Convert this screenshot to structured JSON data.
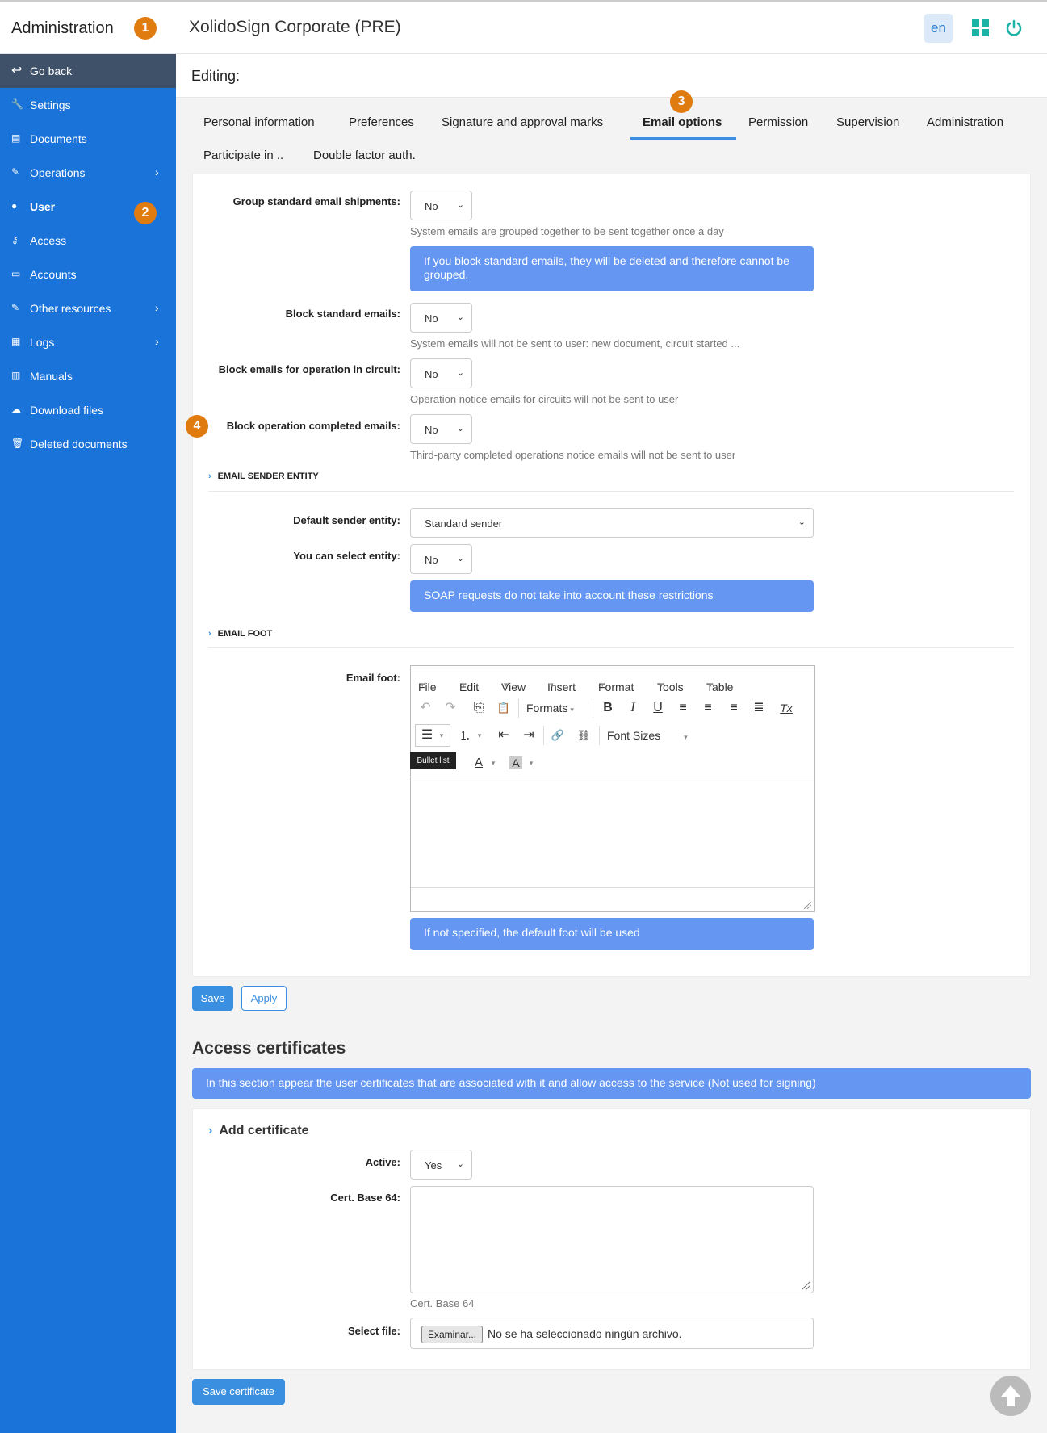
{
  "header": {
    "admin_title": "Administration",
    "app_title": "XolidoSign Corporate (PRE)",
    "lang": "en",
    "badges": [
      "1",
      "2",
      "3",
      "4"
    ]
  },
  "sidebar": {
    "back_label": "Go back",
    "items": [
      {
        "label": "Settings",
        "icon": "wrench-icon"
      },
      {
        "label": "Documents",
        "icon": "document-icon"
      },
      {
        "label": "Operations",
        "icon": "edit-icon",
        "has_children": true
      },
      {
        "label": "User",
        "icon": "user-icon",
        "active": true
      },
      {
        "label": "Access",
        "icon": "key-icon"
      },
      {
        "label": "Accounts",
        "icon": "id-card-icon"
      },
      {
        "label": "Other resources",
        "icon": "edit-icon",
        "has_children": true
      },
      {
        "label": "Logs",
        "icon": "log-icon",
        "has_children": true
      },
      {
        "label": "Manuals",
        "icon": "book-icon"
      },
      {
        "label": "Download files",
        "icon": "cloud-download-icon"
      },
      {
        "label": "Deleted documents",
        "icon": "trash-icon"
      }
    ],
    "chevron": "›"
  },
  "editing": {
    "label": "Editing:"
  },
  "tabs": [
    "Personal information",
    "Preferences",
    "Signature and approval marks",
    "Email options",
    "Permission",
    "Supervision",
    "Administration",
    "Participate in ..",
    "Double factor auth."
  ],
  "form": {
    "group_standard": {
      "label": "Group standard email shipments:",
      "value": "No",
      "help": "System emails are grouped together to be sent together once a day"
    },
    "block_info": "If you block standard emails, they will be deleted and therefore cannot be grouped.",
    "block_standard": {
      "label": "Block standard emails:",
      "value": "No",
      "help": "System emails will not be sent to user: new document, circuit started ..."
    },
    "block_circuit": {
      "label": "Block emails for operation in circuit:",
      "value": "No",
      "help": "Operation notice emails for circuits will not be sent to user"
    },
    "block_completed": {
      "label": "Block operation completed emails:",
      "value": "No",
      "help": "Third-party completed operations notice emails will not be sent to user"
    },
    "sender_section": "EMAIL SENDER ENTITY",
    "default_sender": {
      "label": "Default sender entity:",
      "value": "Standard sender"
    },
    "select_entity": {
      "label": "You can select entity:",
      "value": "No"
    },
    "soap_info": "SOAP requests do not take into account these restrictions",
    "foot_section": "EMAIL FOOT",
    "email_foot_label": "Email foot:",
    "foot_info": "If not specified, the default foot will be used",
    "save": "Save",
    "apply": "Apply"
  },
  "editor": {
    "menus": [
      "File",
      "Edit",
      "View",
      "Insert",
      "Format",
      "Tools",
      "Table"
    ],
    "formats": "Formats",
    "font_sizes": "Font Sizes",
    "tooltip": "Bullet list",
    "dropdown_arrow": "▾",
    "glyphs": {
      "undo": "↶",
      "redo": "↷",
      "copy": "⎘",
      "paste": "📋",
      "bold": "B",
      "italic": "I",
      "underline": "U",
      "clear": "Tx",
      "align_left": "≡",
      "align_center": "≡",
      "align_right": "≡",
      "justify": "≣",
      "bullet": "☰",
      "numbered": "⒈",
      "outdent": "⇤",
      "indent": "⇥",
      "link": "🔗",
      "unlink": "⛓",
      "text_color": "A",
      "bg_color": "A"
    }
  },
  "certs": {
    "title": "Access certificates",
    "info": "In this section appear the user certificates that are associated with it and allow access to the service (Not used for signing)",
    "add": "Add certificate",
    "active": {
      "label": "Active:",
      "value": "Yes"
    },
    "base64": {
      "label": "Cert. Base 64:",
      "help": "Cert. Base 64"
    },
    "file": {
      "label": "Select file:",
      "button": "Examinar...",
      "none": "No se ha seleccionado ningún archivo."
    },
    "save": "Save certificate"
  },
  "colors": {
    "sidebar": "#1a73d9",
    "accent": "#3a8fe0",
    "info": "#6496f2",
    "badge": "#e07b10"
  }
}
